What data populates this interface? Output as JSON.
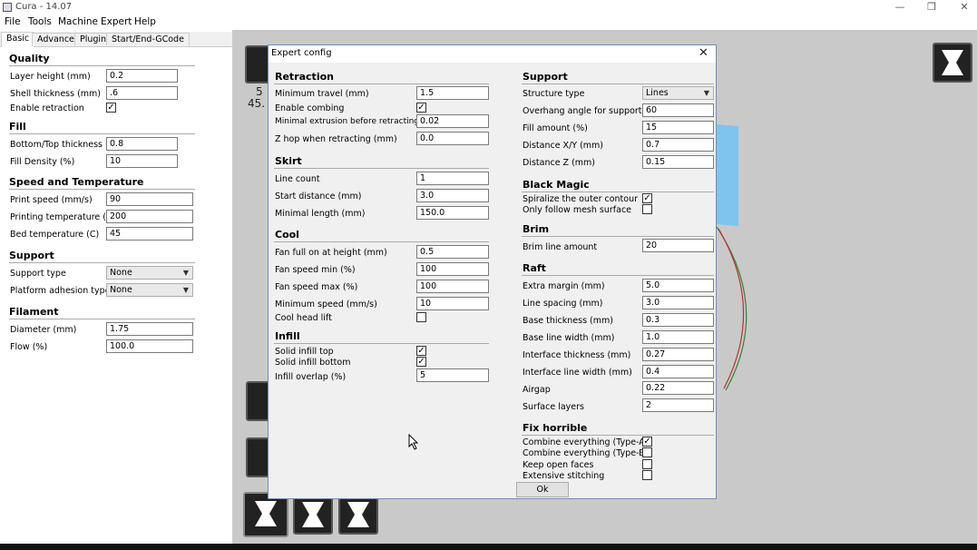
{
  "window": {
    "title": "Cura - 14.07",
    "minimize": "—",
    "restore": "❐",
    "close": "✕"
  },
  "menu": [
    "File",
    "Tools",
    "Machine",
    "Expert",
    "Help"
  ],
  "tabs": [
    "Basic",
    "Advanced",
    "Plugins",
    "Start/End-GCode"
  ],
  "left": {
    "quality": {
      "title": "Quality",
      "layer_height_label": "Layer height (mm)",
      "layer_height": "0.2",
      "shell_label": "Shell thickness (mm)",
      "shell": ".6",
      "retraction_label": "Enable retraction",
      "retraction": "✓"
    },
    "fill": {
      "title": "Fill",
      "bt_label": "Bottom/Top thickness (mm)",
      "bt": "0.8",
      "density_label": "Fill Density (%)",
      "density": "10"
    },
    "speed": {
      "title": "Speed and Temperature",
      "print_speed_label": "Print speed (mm/s)",
      "print_speed": "90",
      "print_temp_label": "Printing temperature (C)",
      "print_temp": "200",
      "bed_temp_label": "Bed temperature (C)",
      "bed_temp": "45"
    },
    "support": {
      "title": "Support",
      "type_label": "Support type",
      "type": "None",
      "adhesion_label": "Platform adhesion type",
      "adhesion": "None"
    },
    "filament": {
      "title": "Filament",
      "diameter_label": "Diameter (mm)",
      "diameter": "1.75",
      "flow_label": "Flow (%)",
      "flow": "100.0"
    }
  },
  "viewport": {
    "info1": "5",
    "info2": "45."
  },
  "dialog": {
    "title": "Expert config",
    "close": "✕",
    "ok": "Ok",
    "retraction": {
      "title": "Retraction",
      "min_travel_label": "Minimum travel (mm)",
      "min_travel": "1.5",
      "combing_label": "Enable combing",
      "combing": "✓",
      "min_extrusion_label": "Minimal extrusion before retracting (mm)",
      "min_extrusion": "0.02",
      "zhop_label": "Z hop when retracting (mm)",
      "zhop": "0.0"
    },
    "skirt": {
      "title": "Skirt",
      "line_count_label": "Line count",
      "line_count": "1",
      "start_distance_label": "Start distance (mm)",
      "start_distance": "3.0",
      "min_length_label": "Minimal length (mm)",
      "min_length": "150.0"
    },
    "cool": {
      "title": "Cool",
      "fan_height_label": "Fan full on at height (mm)",
      "fan_height": "0.5",
      "fan_min_label": "Fan speed min (%)",
      "fan_min": "100",
      "fan_max_label": "Fan speed max (%)",
      "fan_max": "100",
      "min_speed_label": "Minimum speed (mm/s)",
      "min_speed": "10",
      "head_lift_label": "Cool head lift",
      "head_lift": ""
    },
    "infill": {
      "title": "Infill",
      "top_label": "Solid infill top",
      "top": "✓",
      "bottom_label": "Solid infill bottom",
      "bottom": "✓",
      "overlap_label": "Infill overlap (%)",
      "overlap": "5"
    },
    "support": {
      "title": "Support",
      "structure_label": "Structure type",
      "structure": "Lines",
      "overhang_label": "Overhang angle for support (deg)",
      "overhang": "60",
      "fill_label": "Fill amount (%)",
      "fill": "15",
      "dxy_label": "Distance X/Y (mm)",
      "dxy": "0.7",
      "dz_label": "Distance Z (mm)",
      "dz": "0.15"
    },
    "black_magic": {
      "title": "Black Magic",
      "spiralize_label": "Spiralize the outer contour",
      "spiralize": "✓",
      "mesh_label": "Only follow mesh surface",
      "mesh": ""
    },
    "brim": {
      "title": "Brim",
      "lines_label": "Brim line amount",
      "lines": "20"
    },
    "raft": {
      "title": "Raft",
      "margin_label": "Extra margin (mm)",
      "margin": "5.0",
      "spacing_label": "Line spacing (mm)",
      "spacing": "3.0",
      "base_thick_label": "Base thickness (mm)",
      "base_thick": "0.3",
      "base_width_label": "Base line width (mm)",
      "base_width": "1.0",
      "iface_thick_label": "Interface thickness (mm)",
      "iface_thick": "0.27",
      "iface_width_label": "Interface line width (mm)",
      "iface_width": "0.4",
      "airgap_label": "Airgap",
      "airgap": "0.22",
      "surface_label": "Surface layers",
      "surface": "2"
    },
    "fix": {
      "title": "Fix horrible",
      "a_label": "Combine everything (Type-A)",
      "a": "✓",
      "b_label": "Combine everything (Type-B)",
      "b": "",
      "open_label": "Keep open faces",
      "open": "",
      "stitch_label": "Extensive stitching",
      "stitch": ""
    }
  }
}
